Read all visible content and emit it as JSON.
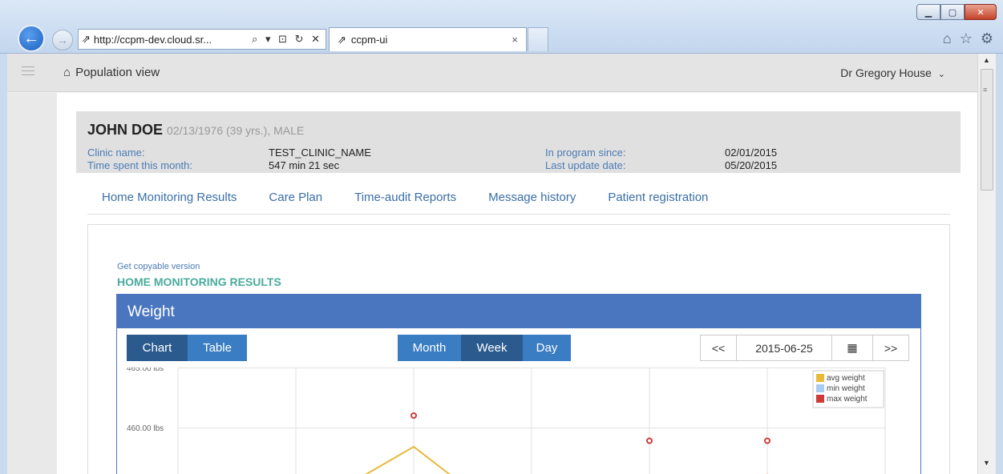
{
  "browser": {
    "url": "http://ccpm-dev.cloud.sr...",
    "tab_title": "ccpm-ui",
    "tab_close": "×",
    "addr_icons": "⌕ ▾ ⊡ ↻ ✕"
  },
  "header": {
    "home_label": "Population view",
    "user_name": "Dr Gregory House"
  },
  "patient": {
    "name": "JOHN DOE",
    "details": "02/13/1976 (39 yrs.), MALE",
    "fields": [
      {
        "label": "Clinic name:",
        "value": "TEST_CLINIC_NAME"
      },
      {
        "label": "Time spent this month:",
        "value": "547 min 21 sec"
      },
      {
        "label": "In program since:",
        "value": "02/01/2015"
      },
      {
        "label": "Last update date:",
        "value": "05/20/2015"
      }
    ]
  },
  "nav_tabs": [
    "Home Monitoring Results",
    "Care Plan",
    "Time-audit Reports",
    "Message history",
    "Patient registration"
  ],
  "section": {
    "copy_link": "Get copyable version",
    "title": "HOME MONITORING RESULTS"
  },
  "weight_panel": {
    "title": "Weight",
    "view_buttons": {
      "chart": "Chart",
      "table": "Table"
    },
    "range_buttons": {
      "month": "Month",
      "week": "Week",
      "day": "Day"
    },
    "prev": "<<",
    "next": ">>",
    "date": "2015-06-25"
  },
  "chart_data": {
    "type": "line",
    "y_tick_labels": [
      "465.00 lbs",
      "460.00 lbs"
    ],
    "ylim": [
      455,
      465
    ],
    "legend": [
      "avg weight",
      "min weight",
      "max weight"
    ],
    "legend_placement": "top-right",
    "colors": {
      "avg": "#e8b93a",
      "min": "#a9cbef",
      "max": "#cf3b3b"
    },
    "series": [
      {
        "name": "avg weight",
        "points": [
          [
            1.4,
            455.0
          ],
          [
            2,
            458.4
          ],
          [
            2.45,
            455.0
          ],
          [
            4.65,
            455.0
          ],
          [
            5,
            456.1
          ],
          [
            5.15,
            455.0
          ]
        ]
      },
      {
        "name": "max weight",
        "points": [
          [
            2,
            461.0
          ],
          [
            4,
            458.9
          ],
          [
            5,
            458.9
          ]
        ]
      }
    ],
    "grid": true
  }
}
